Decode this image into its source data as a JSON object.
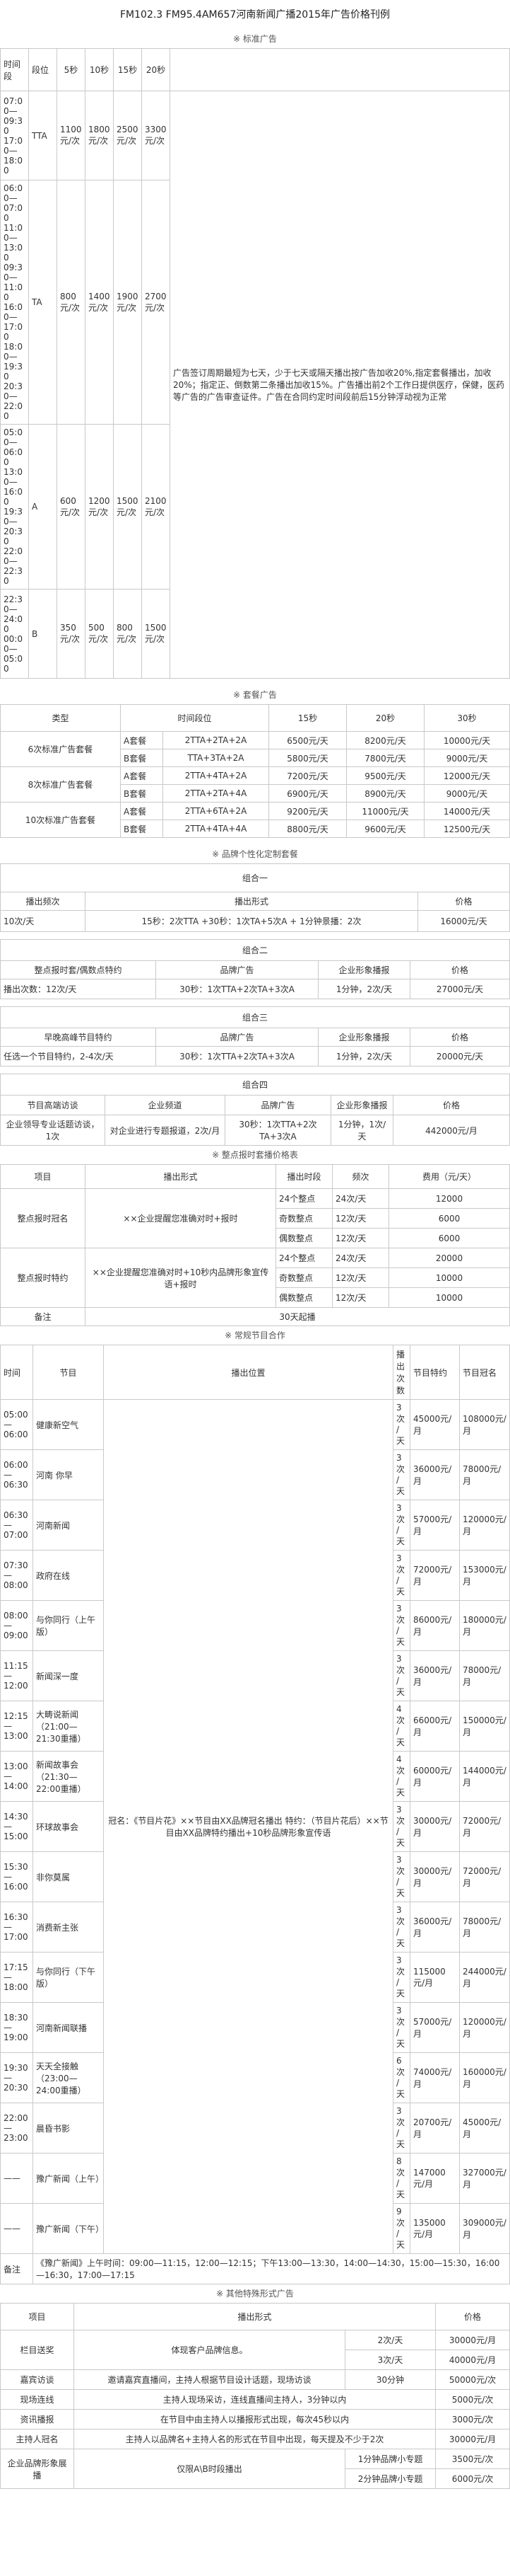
{
  "title": "FM102.3 FM95.4AM657河南新闻广播2015年广告价格刊例",
  "sections": {
    "standard": "※ 标准广告",
    "packages": "※ 套餐广告",
    "custom": "※ 品牌个性化定制套餐",
    "hourly_price": "※ 整点报时套播价格表",
    "program": "※ 常规节目合作",
    "other": "※ 其他特殊形式广告"
  },
  "std": {
    "headers": [
      "时间段",
      "段位",
      "5秒",
      "10秒",
      "15秒",
      "20秒"
    ],
    "rows": [
      {
        "time": "07:00—09:30 17:00—18:00",
        "seg": "TTA",
        "p5": "1100元/次",
        "p10": "1800元/次",
        "p15": "2500元/次",
        "p20": "3300元/次"
      },
      {
        "time": "06:00—07:00 11:00—13:00 09:30—11:00 16:00—17:00 18:00—19:30 20:30—22:00",
        "seg": "TA",
        "p5": "800元/次",
        "p10": "1400元/次",
        "p15": "1900元/次",
        "p20": "2700元/次"
      },
      {
        "time": "05:00—06:00 13:00—16:00 19:30—20:30 22:00—22:30",
        "seg": "A",
        "p5": "600元/次",
        "p10": "1200元/次",
        "p15": "1500元/次",
        "p20": "2100元/次"
      },
      {
        "time": "22:30—24:00 00:00—05:00",
        "seg": "B",
        "p5": "350元/次",
        "p10": "500元/次",
        "p15": "800元/次",
        "p20": "1500元/次"
      }
    ],
    "note": "广告签订周期最短为七天，少于七天或隔天播出按广告加收20%,指定套餐播出，加收20%；指定正、倒数第二条播出加收15%。广告播出前2个工作日提供医疗，保健，医药等广告的广告审查证件。广告在合同约定时间段前后15分钟浮动视为正常"
  },
  "pkg": {
    "headers": [
      "类型",
      "时间段位",
      "15秒",
      "20秒",
      "30秒"
    ],
    "groups": [
      {
        "type": "6次标准广告套餐",
        "rows": [
          {
            "set": "A套餐",
            "pos": "2TTA+2TA+2A",
            "p15": "6500元/天",
            "p20": "8200元/天",
            "p30": "10000元/天"
          },
          {
            "set": "B套餐",
            "pos": "TTA+3TA+2A",
            "p15": "5800元/天",
            "p20": "7800元/天",
            "p30": "9000元/天"
          }
        ]
      },
      {
        "type": "8次标准广告套餐",
        "rows": [
          {
            "set": "A套餐",
            "pos": "2TTA+4TA+2A",
            "p15": "7200元/天",
            "p20": "9500元/天",
            "p30": "12000元/天"
          },
          {
            "set": "B套餐",
            "pos": "2TTA+2TA+4A",
            "p15": "6900元/天",
            "p20": "8900元/天",
            "p30": "9000元/天"
          }
        ]
      },
      {
        "type": "10次标准广告套餐",
        "rows": [
          {
            "set": "A套餐",
            "pos": "2TTA+6TA+2A",
            "p15": "9200元/天",
            "p20": "11000元/天",
            "p30": "14000元/天"
          },
          {
            "set": "B套餐",
            "pos": "2TTA+4TA+4A",
            "p15": "8800元/天",
            "p20": "9600元/天",
            "p30": "12500元/天"
          }
        ]
      }
    ]
  },
  "combo1": {
    "title": "组合一",
    "headers": [
      "播出频次",
      "播出形式",
      "价格"
    ],
    "row": [
      "10次/天",
      "15秒：2次TTA +30秒：1次TA+5次A + 1分钟景播：2次",
      "16000元/天"
    ]
  },
  "combo2": {
    "title": "组合二",
    "headers": [
      "整点报时套/偶数点特约",
      "品牌广告",
      "企业形象播报",
      "价格"
    ],
    "row": [
      "播出次数：12次/天",
      "30秒：1次TTA+2次TA+3次A",
      "1分钟，2次/天",
      "27000元/天"
    ]
  },
  "combo3": {
    "title": "组合三",
    "headers": [
      "早晚高峰节目特约",
      "品牌广告",
      "企业形象播报",
      "价格"
    ],
    "row": [
      "任选一个节目特约，2-4次/天",
      "30秒：1次TTA+2次TA+3次A",
      "1分钟，2次/天",
      "20000元/天"
    ]
  },
  "combo4": {
    "title": "组合四",
    "headers": [
      "节目高端访谈",
      "企业频道",
      "品牌广告",
      "企业形象播报",
      "价格"
    ],
    "row": [
      "企业领导专业话题访谈，1次",
      "对企业进行专题报道，2次/月",
      "30秒：1次TTA+2次TA+3次A",
      "1分钟，1次/天",
      "442000元/月"
    ]
  },
  "hourly": {
    "headers": [
      "项目",
      "播出形式",
      "播出时段",
      "频次",
      "费用（元/天）"
    ],
    "groups": [
      {
        "item": "整点报时冠名",
        "form": "××企业提醒您准确对时+报时",
        "rows": [
          {
            "slot": "24个整点",
            "freq": "24次/天",
            "fee": "12000"
          },
          {
            "slot": "奇数整点",
            "freq": "12次/天",
            "fee": "6000"
          },
          {
            "slot": "偶数整点",
            "freq": "12次/天",
            "fee": "6000"
          }
        ]
      },
      {
        "item": "整点报时特约",
        "form": "××企业提醒您准确对时+10秒内品牌形象宣传语+报时",
        "rows": [
          {
            "slot": "24个整点",
            "freq": "24次/天",
            "fee": "20000"
          },
          {
            "slot": "奇数整点",
            "freq": "12次/天",
            "fee": "10000"
          },
          {
            "slot": "偶数整点",
            "freq": "12次/天",
            "fee": "10000"
          }
        ]
      }
    ],
    "note_label": "备注",
    "note": "30天起播"
  },
  "prog": {
    "headers": [
      "时间",
      "节目",
      "播出位置",
      "播出次数",
      "节目特约",
      "节目冠名"
    ],
    "position": "冠名：《节目片花》××节目由XX品牌冠名播出 特约：（节目片花后）××节目由XX品牌特约播出+10秒品牌形象宣传语",
    "rows": [
      {
        "time": "05:00—06:00",
        "name": "健康新空气",
        "times": "3次/天",
        "sp": "45000元/月",
        "title": "108000元/月"
      },
      {
        "time": "06:00—06:30",
        "name": "河南 你早",
        "times": "3次/天",
        "sp": "36000元/月",
        "title": "78000元/月"
      },
      {
        "time": "06:30—07:00",
        "name": "河南新闻",
        "times": "3次/天",
        "sp": "57000元/月",
        "title": "120000元/月"
      },
      {
        "time": "07:30—08:00",
        "name": "政府在线",
        "times": "3次/天",
        "sp": "72000元/月",
        "title": "153000元/月"
      },
      {
        "time": "08:00—09:00",
        "name": "与你同行（上午版）",
        "times": "3次/天",
        "sp": "86000元/月",
        "title": "180000元/月"
      },
      {
        "time": "11:15—12:00",
        "name": "新闻深一度",
        "times": "3次/天",
        "sp": "36000元/月",
        "title": "78000元/月"
      },
      {
        "time": "12:15—13:00",
        "name": "大畴说新闻（21:00—21:30重播）",
        "times": "4次/天",
        "sp": "66000元/月",
        "title": "150000元/月"
      },
      {
        "time": "13:00—14:00",
        "name": "新闻故事会（21:30—22:00重播）",
        "times": "4次/天",
        "sp": "60000元/月",
        "title": "144000元/月"
      },
      {
        "time": "14:30—15:00",
        "name": "环球故事会",
        "times": "3次/天",
        "sp": "30000元/月",
        "title": "72000元/月"
      },
      {
        "time": "15:30—16:00",
        "name": "非你莫属",
        "times": "3次/天",
        "sp": "30000元/月",
        "title": "72000元/月"
      },
      {
        "time": "16:30—17:00",
        "name": "消费新主张",
        "times": "3次/天",
        "sp": "36000元/月",
        "title": "78000元/月"
      },
      {
        "time": "17:15—18:00",
        "name": "与你同行（下午版）",
        "times": "3次/天",
        "sp": "115000元/月",
        "title": "244000元/月"
      },
      {
        "time": "18:30—19:00",
        "name": "河南新闻联播",
        "times": "3次/天",
        "sp": "57000元/月",
        "title": "120000元/月"
      },
      {
        "time": "19:30—20:30",
        "name": "天天全接触（23:00—24:00重播）",
        "times": "6次/天",
        "sp": "74000元/月",
        "title": "160000元/月"
      },
      {
        "time": "22:00—23:00",
        "name": "晨昏书影",
        "times": "3次/天",
        "sp": "20700元/月",
        "title": "45000元/月"
      },
      {
        "time": "——",
        "name": "豫广新闻（上午）",
        "times": "8次/天",
        "sp": "147000元/月",
        "title": "327000元/月"
      },
      {
        "time": "——",
        "name": "豫广新闻（下午）",
        "times": "9次/天",
        "sp": "135000元/月",
        "title": "309000元/月"
      }
    ],
    "note_label": "备注",
    "note": "《豫广新闻》上午时间：09:00—11:15，12:00—12:15；下午13:00—13:30，14:00—14:30，15:00—15:30，16:00—16:30，17:00—17:15"
  },
  "other": {
    "headers": [
      "项目",
      "播出形式",
      "价格"
    ],
    "rows": [
      {
        "item": "栏目送奖",
        "form": "体现客户品牌信息。",
        "freq": "2次/天",
        "price": "30000元/月"
      },
      {
        "item": "",
        "form": "",
        "freq": "3次/天",
        "price": "40000元/月"
      },
      {
        "item": "嘉宾访谈",
        "form": "邀请嘉宾直播间，主持人根据节目设计话题，现场访谈",
        "freq": "30分钟",
        "price": "50000元/次"
      },
      {
        "item": "现场连线",
        "form": "主持人现场采访，连线直播间主持人，3分钟以内",
        "freq": "",
        "price": "5000元/次"
      },
      {
        "item": "资讯播报",
        "form": "在节目中由主持人以播报形式出现，每次45秒以内",
        "freq": "",
        "price": "3000元/次"
      },
      {
        "item": "主持人冠名",
        "form": "主持人以品牌名+主持人名的形式在节目中出现，每天提及不少于2次",
        "freq": "",
        "price": "30000元/月"
      },
      {
        "item": "企业品牌形象展播",
        "form": "仅限A\\B时段播出",
        "freq": "1分钟品牌小专题",
        "price": "3500元/次"
      },
      {
        "item": "",
        "form": "",
        "freq": "2分钟品牌小专题",
        "price": "6000元/次"
      }
    ]
  }
}
